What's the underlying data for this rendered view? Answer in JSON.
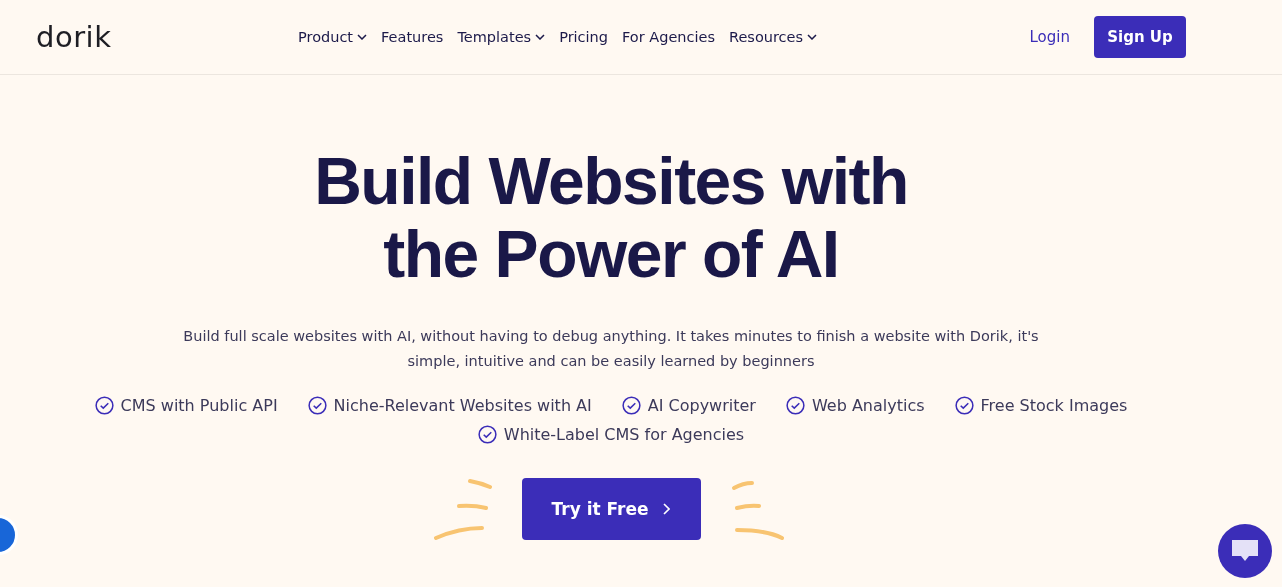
{
  "header": {
    "logo": "dorik",
    "nav": [
      {
        "label": "Product",
        "has_menu": true
      },
      {
        "label": "Features",
        "has_menu": false
      },
      {
        "label": "Templates",
        "has_menu": true
      },
      {
        "label": "Pricing",
        "has_menu": false
      },
      {
        "label": "For Agencies",
        "has_menu": false
      },
      {
        "label": "Resources",
        "has_menu": true
      }
    ],
    "login": "Login",
    "signup": "Sign Up"
  },
  "hero": {
    "title_lines": [
      "Build Websites with",
      "the Power of AI"
    ],
    "description": "Build full scale websites with AI, without having to debug anything. It takes minutes to finish a website with Dorik, it's simple, intuitive and can be easily learned by beginners",
    "features": [
      "CMS with Public API",
      "Niche-Relevant Websites with AI",
      "AI Copywriter",
      "Web Analytics",
      "Free Stock Images",
      "White-Label CMS for Agencies"
    ],
    "cta": "Try it Free"
  }
}
